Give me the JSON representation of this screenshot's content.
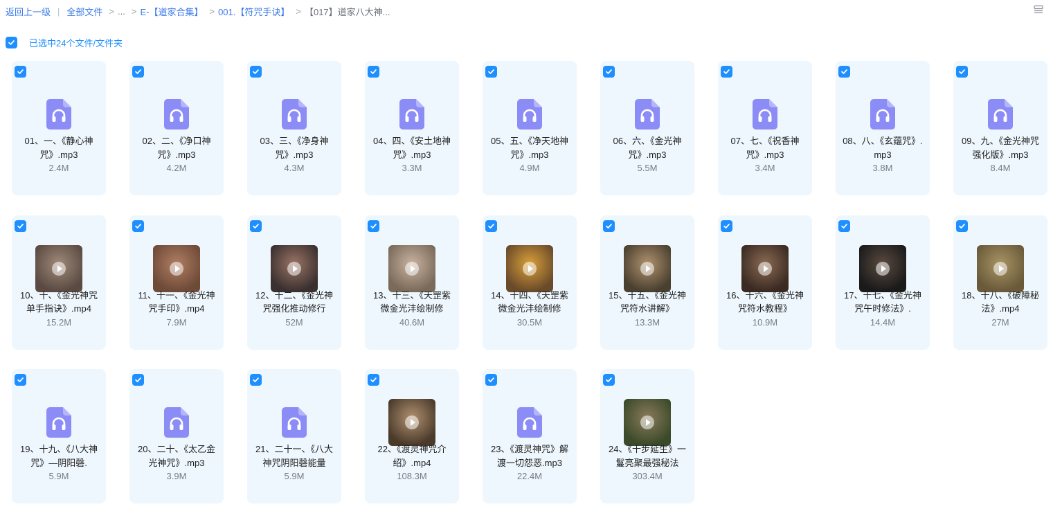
{
  "breadcrumb": {
    "back": "返回上一级",
    "all_files": "全部文件",
    "ellipsis": "...",
    "level1": "E-【道家合集】",
    "level2": "001.【符咒手诀】",
    "current": "【017】道家八大神..."
  },
  "view_toggle_icon": "list-view-icon",
  "selection": {
    "label": "已选中24个文件/文件夹",
    "checked": true
  },
  "colors": {
    "accent": "#1f8fff",
    "card_bg": "#eef7fd",
    "audio_icon": "#8c8cf7"
  },
  "files": [
    {
      "name": "01、一、《静心神咒》.mp3",
      "size": "2.4M",
      "type": "audio"
    },
    {
      "name": "02、二、《净口神咒》.mp3",
      "size": "4.2M",
      "type": "audio"
    },
    {
      "name": "03、三、《净身神咒》.mp3",
      "size": "4.3M",
      "type": "audio"
    },
    {
      "name": "04、四、《安土地神咒》.mp3",
      "size": "3.3M",
      "type": "audio"
    },
    {
      "name": "05、五、《净天地神咒》.mp3",
      "size": "4.9M",
      "type": "audio"
    },
    {
      "name": "06、六、《金光神咒》.mp3",
      "size": "5.5M",
      "type": "audio"
    },
    {
      "name": "07、七、《祝香神咒》.mp3",
      "size": "3.4M",
      "type": "audio"
    },
    {
      "name": "08、八、《玄蕴咒》.mp3",
      "size": "3.8M",
      "type": "audio"
    },
    {
      "name": "09、九、《金光神咒强化版》.mp3",
      "size": "8.4M",
      "type": "audio"
    },
    {
      "name": "10、十、《金光神咒单手指诀》.mp4",
      "size": "15.2M",
      "type": "video"
    },
    {
      "name": "11、十一、《金光神咒手印》.mp4",
      "size": "7.9M",
      "type": "video"
    },
    {
      "name": "12、十二、《金光神咒强化推动修行",
      "size": "52M",
      "type": "video"
    },
    {
      "name": "13、十三、《天罡紫微金光沣绘制修",
      "size": "40.6M",
      "type": "video"
    },
    {
      "name": "14、十四、《天罡紫微金光沣绘制修",
      "size": "30.5M",
      "type": "video"
    },
    {
      "name": "15、十五、《金光神咒符水讲解》",
      "size": "13.3M",
      "type": "video"
    },
    {
      "name": "16、十六、《金光神咒符水教程》",
      "size": "10.9M",
      "type": "video"
    },
    {
      "name": "17、十七、《金光神咒午时修法》.",
      "size": "14.4M",
      "type": "video"
    },
    {
      "name": "18、十八、《破障秘法》.mp4",
      "size": "27M",
      "type": "video"
    },
    {
      "name": "19、十九、《八大神咒》—阴阳磬.",
      "size": "5.9M",
      "type": "audio"
    },
    {
      "name": "20、二十、《太乙金光神咒》.mp3",
      "size": "3.9M",
      "type": "audio"
    },
    {
      "name": "21、二十一、《八大神咒阴阳磬能量",
      "size": "5.9M",
      "type": "audio"
    },
    {
      "name": "22、《渡灵神咒介绍》.mp4",
      "size": "108.3M",
      "type": "video"
    },
    {
      "name": "23、《渡灵神咒》解渡一切怨恶.mp3",
      "size": "22.4M",
      "type": "audio"
    },
    {
      "name": "24、《十步延生》一鬘亮聚最强秘法",
      "size": "303.4M",
      "type": "video"
    }
  ]
}
